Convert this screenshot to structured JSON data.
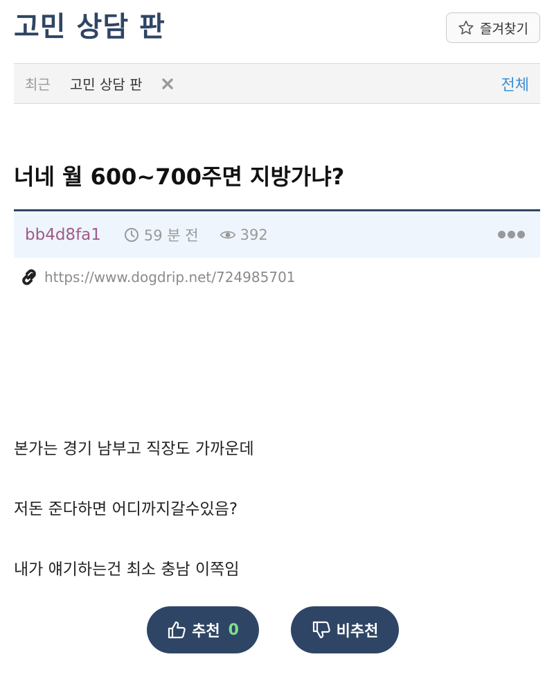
{
  "board": {
    "title": "고민 상담 판",
    "favorite_label": "즐겨찾기"
  },
  "recent": {
    "label": "최근",
    "items": [
      "고민 상담 판"
    ],
    "all_label": "전체"
  },
  "post": {
    "title": "너네 월 600~700주면 지방가냐?",
    "author": "bb4d8fa1",
    "time": "59 분 전",
    "views": "392",
    "url": "https://www.dogdrip.net/724985701",
    "paragraphs": [
      "본가는 경기 남부고 직장도 가까운데",
      "저돈 준다하면 어디까지갈수있음?",
      "내가 얘기하는건 최소 충남 이쪽임"
    ]
  },
  "votes": {
    "up_label": "추천",
    "up_count": "0",
    "down_label": "비추천"
  },
  "colors": {
    "brand": "#2f4565",
    "author": "#a05a87",
    "link": "#3b8fd6",
    "vote_count": "#7fe08f"
  }
}
